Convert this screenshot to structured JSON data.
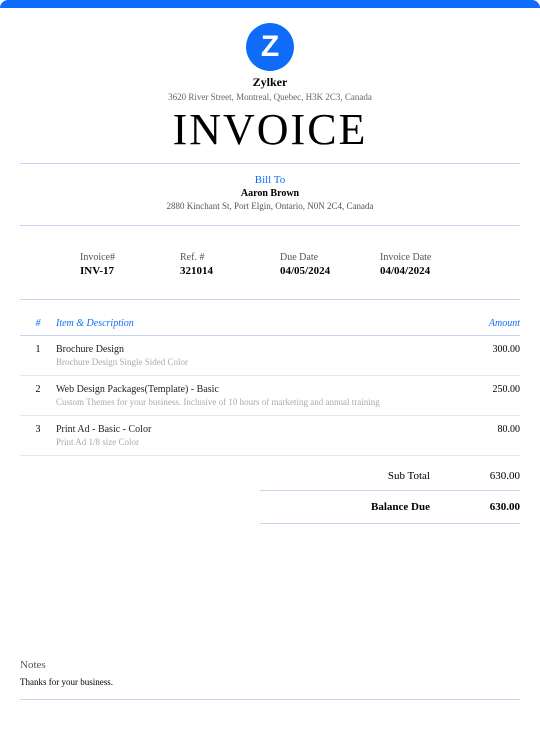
{
  "company": {
    "logo_letter": "Z",
    "name": "Zylker",
    "address": "3620 River Street, Montreal, Quebec, H3K 2C3, Canada"
  },
  "title": "INVOICE",
  "bill_to": {
    "label": "Bill To",
    "name": "Aaron Brown",
    "address": "2880 Kinchant St, Port Elgin, Ontario, N0N 2C4, Canada"
  },
  "meta": {
    "invoice_num_label": "Invoice#",
    "invoice_num": "INV-17",
    "ref_label": "Ref. #",
    "ref": "321014",
    "due_date_label": "Due Date",
    "due_date": "04/05/2024",
    "invoice_date_label": "Invoice Date",
    "invoice_date": "04/04/2024"
  },
  "columns": {
    "num": "#",
    "desc": "Item & Description",
    "amount": "Amount"
  },
  "items": [
    {
      "num": "1",
      "name": "Brochure Design",
      "detail": "Brochure Design Single Sided Color",
      "amount": "300.00"
    },
    {
      "num": "2",
      "name": "Web Design Packages(Template) - Basic",
      "detail": "Custom Themes for your business. Inclusive of 10 hours of marketing and annual training",
      "amount": "250.00"
    },
    {
      "num": "3",
      "name": "Print Ad - Basic - Color",
      "detail": "Print Ad 1/8 size Color",
      "amount": "80.00"
    }
  ],
  "totals": {
    "subtotal_label": "Sub Total",
    "subtotal": "630.00",
    "balance_label": "Balance Due",
    "balance": "630.00"
  },
  "notes": {
    "label": "Notes",
    "text": "Thanks for your business."
  }
}
